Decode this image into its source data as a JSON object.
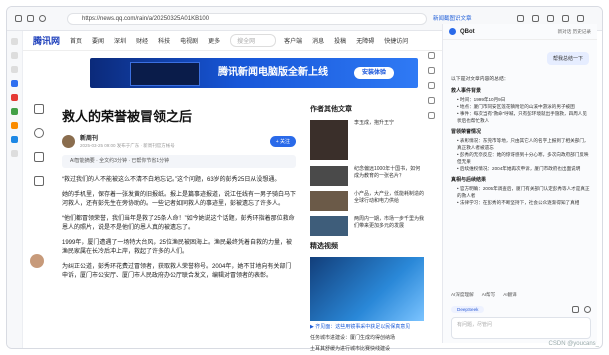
{
  "browser": {
    "url": "https://news.qq.com/rain/a/20250325A01KB100",
    "tab_label": "新闻截图识文章"
  },
  "site": {
    "logo": "腾讯网",
    "nav": [
      "首页",
      "要闻",
      "深圳",
      "财经",
      "科技",
      "电视剧",
      "更多"
    ],
    "search_placeholder": "搜全网",
    "right_nav": [
      "客户端",
      "消息",
      "投稿",
      "无障碍",
      "快捷访问"
    ]
  },
  "banner": {
    "title": "腾讯新闻电脑版全新上线",
    "button": "安装体验"
  },
  "share_labels": [
    "分享",
    "评论",
    "收藏",
    "转发"
  ],
  "article": {
    "title": "救人的荣誉被冒领之后",
    "author": "新周刊",
    "meta": "2025-03-25 09:00 发布于广东 · 新周刊官方帐号",
    "follow": "+ 关注",
    "ai_summary": "AI智能摘要 · 全文约3分钟 · 已帮你节省1分钟",
    "paragraphs": [
      "“救过我们的人不能被这么不清不白地忘记。”这个问题，63岁的彭秀25日从没想通。",
      "她的手机里，保存着一张发黄的旧报纸。报上是篇事迹报道，说江任线有一男子骑白马下河救人，还有彭先生在旁协助的。一些记者如同救人的事迹里，彭被遗忘了许多人。",
      "“他们都冒领荣誉，我们当年是救了25条人命！”如今她说这个话题，彭秀环指着那位救命恩人的照片，说是不是他们的恩人真的被遗忘了。",
      "1999年，厦门遭遇了一场特大台风，25位渔民被困海上。渔民最终凭着自救的力量，被渔民家属在长冷后冲上岸，救起了许多的人们。",
      "为纠正公道，彭秀环花费过冒领者，获取救人荣誉称号。2004年，她不甘地向有关部门申诉，厦门市公安厅、厦门市人民政府办公厅联合发文，编辑对冒领者的表彰。"
    ]
  },
  "rail": {
    "author_heading": "作者其他文章",
    "hero_text": "李玉成，抱升王宁",
    "items": [
      "纪念偏远1000年十国书，如何成为教育的一张名片？",
      "小产品，大产业，低能耗制造的全球行动和电力供给",
      "两周内一期，市场一步千里为我们带来更加多元的发展"
    ],
    "featured_heading": "精选视频",
    "featured_caption": "▶ 齐见面：这些用镜事采中获足以民保真意见",
    "lines": [
      "任务城市进建设：厦门生成均得创纳场",
      "土耳其舒缓为进行城市比赛快线建设"
    ]
  },
  "tools_labels": [
    "返回顶部",
    "刷新"
  ],
  "qbot": {
    "name": "QBot",
    "header_right": "新对话   历史记录",
    "user_bubble": "帮我总结一下",
    "intro": "以下是对文章内容的总结：",
    "sections": [
      {
        "heading": "救人事件背景",
        "bullets": [
          "• 时间：1999年10月9日",
          "• 地点：厦门市同安区莲花镇附近的山溪中游泳的男子被困",
          "• 事件：每次当有“救命”呼喊，只有彭环境就出手施救，四周人见状后也帮忙救人"
        ]
      },
      {
        "heading": "冒领荣誉情况",
        "bullets": [
          "• 表彰情况：东莞市等地，只由其它人的名字上报到了相关部门，真正救人者被遗忘",
          "• 彭秀的无奈反应：她的惊讶感到十分心寒，多次向政府部门反映但无果",
          "• 后续维权情况：2004年她再次申诉，厦门市政府也出面说明"
        ]
      },
      {
        "heading": "真相与后续结果",
        "bullets": [
          "• 官方明确：2005年调查后，厦门有关部门认定彭秀等人才是真正的救人者",
          "• 法律学习：在彭秀的不断坚持下，社会公众逐渐得知了真相"
        ]
      }
    ],
    "actions": [
      "AI深度理解",
      "AI帮写",
      "AI翻译"
    ],
    "model": "DeepSeek",
    "input_placeholder": "有问题，尽管问"
  },
  "watermark": "CSDN @youcans_",
  "colors": {
    "accent": "#2a6ae9",
    "brand": "#1d3fbb"
  }
}
